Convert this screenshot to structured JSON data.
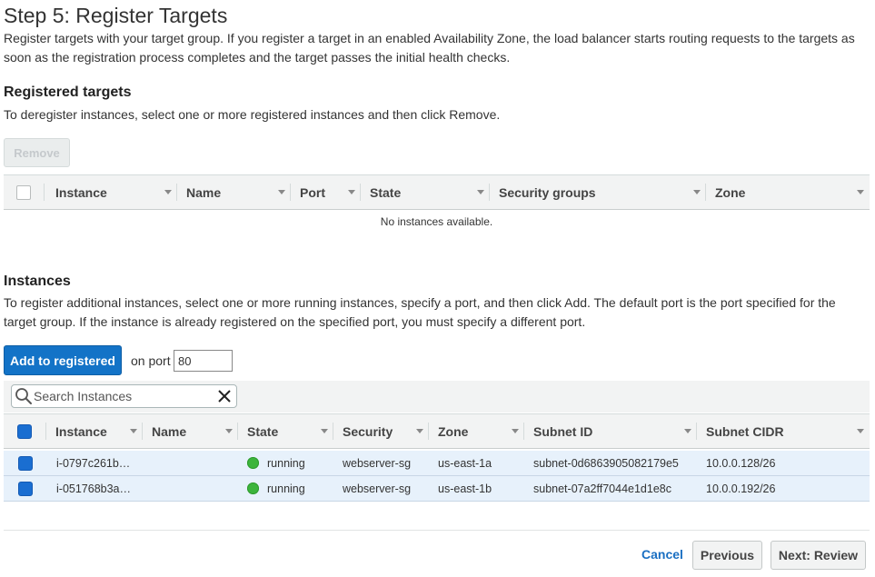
{
  "page": {
    "title": "Step 5: Register Targets",
    "description": "Register targets with your target group. If you register a target in an enabled Availability Zone, the load balancer starts routing requests to the targets as soon as the registration process completes and the target passes the initial health checks."
  },
  "registered": {
    "title": "Registered targets",
    "description": "To deregister instances, select one or more registered instances and then click Remove.",
    "remove_label": "Remove",
    "columns": [
      "Instance",
      "Name",
      "Port",
      "State",
      "Security groups",
      "Zone"
    ],
    "empty_message": "No instances available."
  },
  "instances": {
    "title": "Instances",
    "description": "To register additional instances, select one or more running instances, specify a port, and then click Add. The default port is the port specified for the target group. If the instance is already registered on the specified port, you must specify a different port.",
    "add_label": "Add to registered",
    "port_label": "on port",
    "port_value": "80",
    "search_placeholder": "Search Instances",
    "columns": [
      "Instance",
      "Name",
      "State",
      "Security",
      "Zone",
      "Subnet ID",
      "Subnet CIDR"
    ],
    "rows": [
      {
        "instance": "i-0797c261b…",
        "name": "",
        "state": "running",
        "security": "webserver-sg",
        "zone": "us-east-1a",
        "subnet_id": "subnet-0d6863905082179e5",
        "subnet_cidr": "10.0.0.128/26",
        "selected": true
      },
      {
        "instance": "i-051768b3a…",
        "name": "",
        "state": "running",
        "security": "webserver-sg",
        "zone": "us-east-1b",
        "subnet_id": "subnet-07a2ff7044e1d1e8c",
        "subnet_cidr": "10.0.0.192/26",
        "selected": true
      }
    ]
  },
  "footer": {
    "cancel_label": "Cancel",
    "previous_label": "Previous",
    "next_label": "Next: Review"
  },
  "colors": {
    "primary": "#1373c7",
    "link": "#1a6fc2",
    "running": "#3cb43c",
    "selected_row": "#e7f1fb",
    "header_bg": "#f2f3f3"
  },
  "icons": {
    "search": "search-icon",
    "clear": "close-icon",
    "sort": "caret-down-icon",
    "status": "status-dot-icon"
  }
}
